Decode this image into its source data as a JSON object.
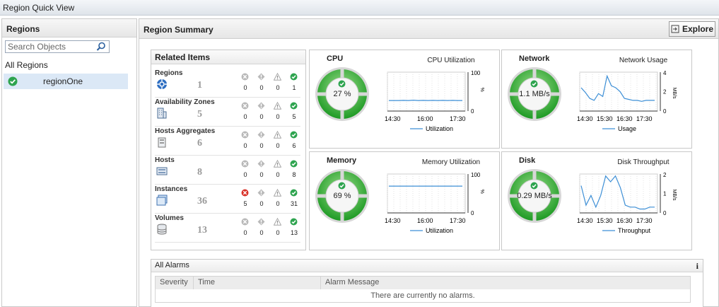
{
  "window": {
    "title": "Region Quick View"
  },
  "regions_pane": {
    "title": "Regions",
    "search_placeholder": "Search Objects",
    "all_label": "All Regions",
    "items": [
      {
        "label": "regionOne",
        "status": "ok"
      }
    ]
  },
  "summary": {
    "title": "Region Summary",
    "explore_label": "Explore"
  },
  "related": {
    "title": "Related Items",
    "items": [
      {
        "name": "Regions",
        "count": "1",
        "icon": "region-icon",
        "status": [
          "0",
          "0",
          "0",
          "1"
        ],
        "critical": false
      },
      {
        "name": "Availability Zones",
        "count": "5",
        "icon": "building-icon",
        "status": [
          "0",
          "0",
          "0",
          "5"
        ],
        "critical": false
      },
      {
        "name": "Hosts Aggregates",
        "count": "6",
        "icon": "aggregate-icon",
        "status": [
          "0",
          "0",
          "0",
          "6"
        ],
        "critical": false
      },
      {
        "name": "Hosts",
        "count": "8",
        "icon": "host-icon",
        "status": [
          "0",
          "0",
          "0",
          "8"
        ],
        "critical": false
      },
      {
        "name": "Instances",
        "count": "36",
        "icon": "instance-icon",
        "status": [
          "5",
          "0",
          "0",
          "31"
        ],
        "critical": true
      },
      {
        "name": "Volumes",
        "count": "13",
        "icon": "volume-icon",
        "status": [
          "0",
          "0",
          "0",
          "13"
        ],
        "critical": false
      }
    ]
  },
  "metrics": {
    "cpu": {
      "title": "CPU",
      "gauge": "27 %",
      "chart_title": "CPU Utilization",
      "ymax": "100",
      "ymin": "0",
      "unit": "%",
      "legend": "Utilization",
      "x_ticks": [
        "14:30",
        "16:00",
        "17:30"
      ],
      "points": [
        27,
        27,
        27,
        27.5,
        27,
        28,
        27,
        27.5,
        27,
        27.5,
        27,
        27.5,
        27,
        27.5,
        27,
        27
      ]
    },
    "network": {
      "title": "Network",
      "gauge": "1.1 MB/s",
      "chart_title": "Network Usage",
      "ymax": "4",
      "ymin": "0",
      "unit": "MB/s",
      "y_mid": "2",
      "legend": "Usage",
      "x_ticks": [
        "14:30",
        "15:30",
        "16:30",
        "17:30"
      ],
      "points": [
        2.4,
        1.9,
        1.3,
        1.1,
        1.8,
        1.5,
        3.6,
        2.6,
        2.4,
        2.0,
        1.3,
        1.2,
        1.1,
        1.1,
        1.0,
        1.1,
        1.1,
        1.1
      ]
    },
    "memory": {
      "title": "Memory",
      "gauge": "69 %",
      "chart_title": "Memory Utilization",
      "ymax": "100",
      "ymin": "0",
      "unit": "%",
      "legend": "Utilization",
      "x_ticks": [
        "14:30",
        "16:00",
        "17:30"
      ],
      "points": [
        69,
        69,
        69,
        69,
        69,
        69,
        69,
        69,
        69,
        69,
        69,
        69,
        69,
        69,
        69,
        69
      ]
    },
    "disk": {
      "title": "Disk",
      "gauge": "0.29 MB/s",
      "chart_title": "Disk Throughput",
      "ymax": "2",
      "ymin": "0",
      "unit": "MB/s",
      "y_mid": "1",
      "legend": "Throughput",
      "x_ticks": [
        "14:30",
        "15:30",
        "16:30",
        "17:30"
      ],
      "points": [
        1.4,
        0.4,
        0.9,
        0.3,
        0.9,
        1.9,
        1.6,
        1.9,
        1.3,
        0.4,
        0.3,
        0.3,
        0.2,
        0.2,
        0.3,
        0.3
      ]
    }
  },
  "alarms": {
    "title": "All Alarms",
    "info": "i",
    "columns": [
      "Severity",
      "Time",
      "Alarm Message"
    ],
    "empty_message": "There are currently no alarms."
  },
  "colors": {
    "ok": "#2ea44f",
    "critical": "#d9342b",
    "line": "#3d8fd6",
    "gauge": "#3ab53a"
  }
}
